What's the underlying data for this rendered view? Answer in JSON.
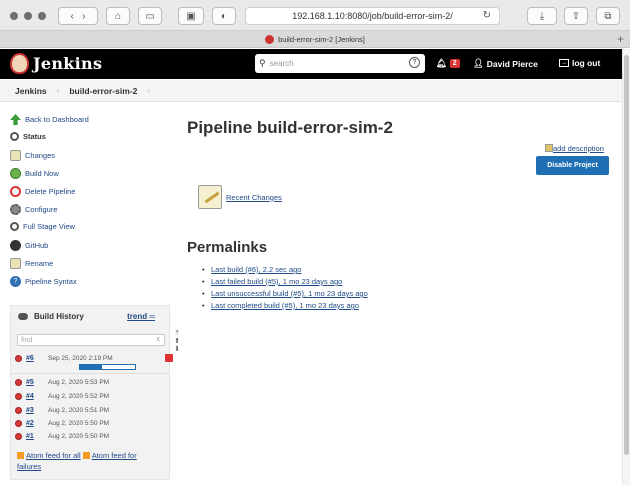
{
  "browser": {
    "url": "192.168.1.10:8080/job/build-error-sim-2/",
    "tab_title": "build-error-sim-2 [Jenkins]"
  },
  "header": {
    "app_name": "Jenkins",
    "search_placeholder": "search",
    "notification_count": "2",
    "user_name": "David Pierce",
    "logout_label": "log out"
  },
  "breadcrumb": [
    "Jenkins",
    "build-error-sim-2"
  ],
  "sidebar": {
    "tasks": [
      {
        "label": "Back to Dashboard",
        "icon": "up-arrow-icon"
      },
      {
        "label": "Status",
        "icon": "search-icon"
      },
      {
        "label": "Changes",
        "icon": "notepad-icon"
      },
      {
        "label": "Build Now",
        "icon": "clock-icon"
      },
      {
        "label": "Delete Pipeline",
        "icon": "no-entry-icon"
      },
      {
        "label": "Configure",
        "icon": "gear-icon"
      },
      {
        "label": "Full Stage View",
        "icon": "search-icon"
      },
      {
        "label": "GitHub",
        "icon": "github-icon"
      },
      {
        "label": "Rename",
        "icon": "notepad-icon"
      },
      {
        "label": "Pipeline Syntax",
        "icon": "help-icon"
      }
    ]
  },
  "build_history": {
    "title": "Build History",
    "trend_label": "trend",
    "find_placeholder": "find",
    "builds": [
      {
        "number": "#6",
        "date": "Sep 25, 2020 2:19 PM",
        "progress": 0.4
      },
      {
        "number": "#5",
        "date": "Aug 2, 2020 5:53 PM"
      },
      {
        "number": "#4",
        "date": "Aug 2, 2020 5:52 PM"
      },
      {
        "number": "#3",
        "date": "Aug 2, 2020 5:51 PM"
      },
      {
        "number": "#2",
        "date": "Aug 2, 2020 5:50 PM"
      },
      {
        "number": "#1",
        "date": "Aug 2, 2020 5:50 PM"
      }
    ],
    "feed_all": "Atom feed for all",
    "feed_failures_prefix": "Atom feed for",
    "feed_failures_suffix": "failures"
  },
  "main": {
    "title": "Pipeline build-error-sim-2",
    "add_description": "add description",
    "disable_button": "Disable Project",
    "recent_changes": "Recent Changes",
    "permalinks_title": "Permalinks",
    "permalinks": [
      "Last build (#6), 2.2 sec ago",
      "Last failed build (#5), 1 mo 23 days ago",
      "Last unsuccessful build (#5), 1 mo 23 days ago",
      "Last completed build (#5), 1 mo 23 days ago"
    ]
  },
  "colors": {
    "accent": "#1f6fb5",
    "failed": "#d43a3a",
    "header_bg": "#000000"
  }
}
